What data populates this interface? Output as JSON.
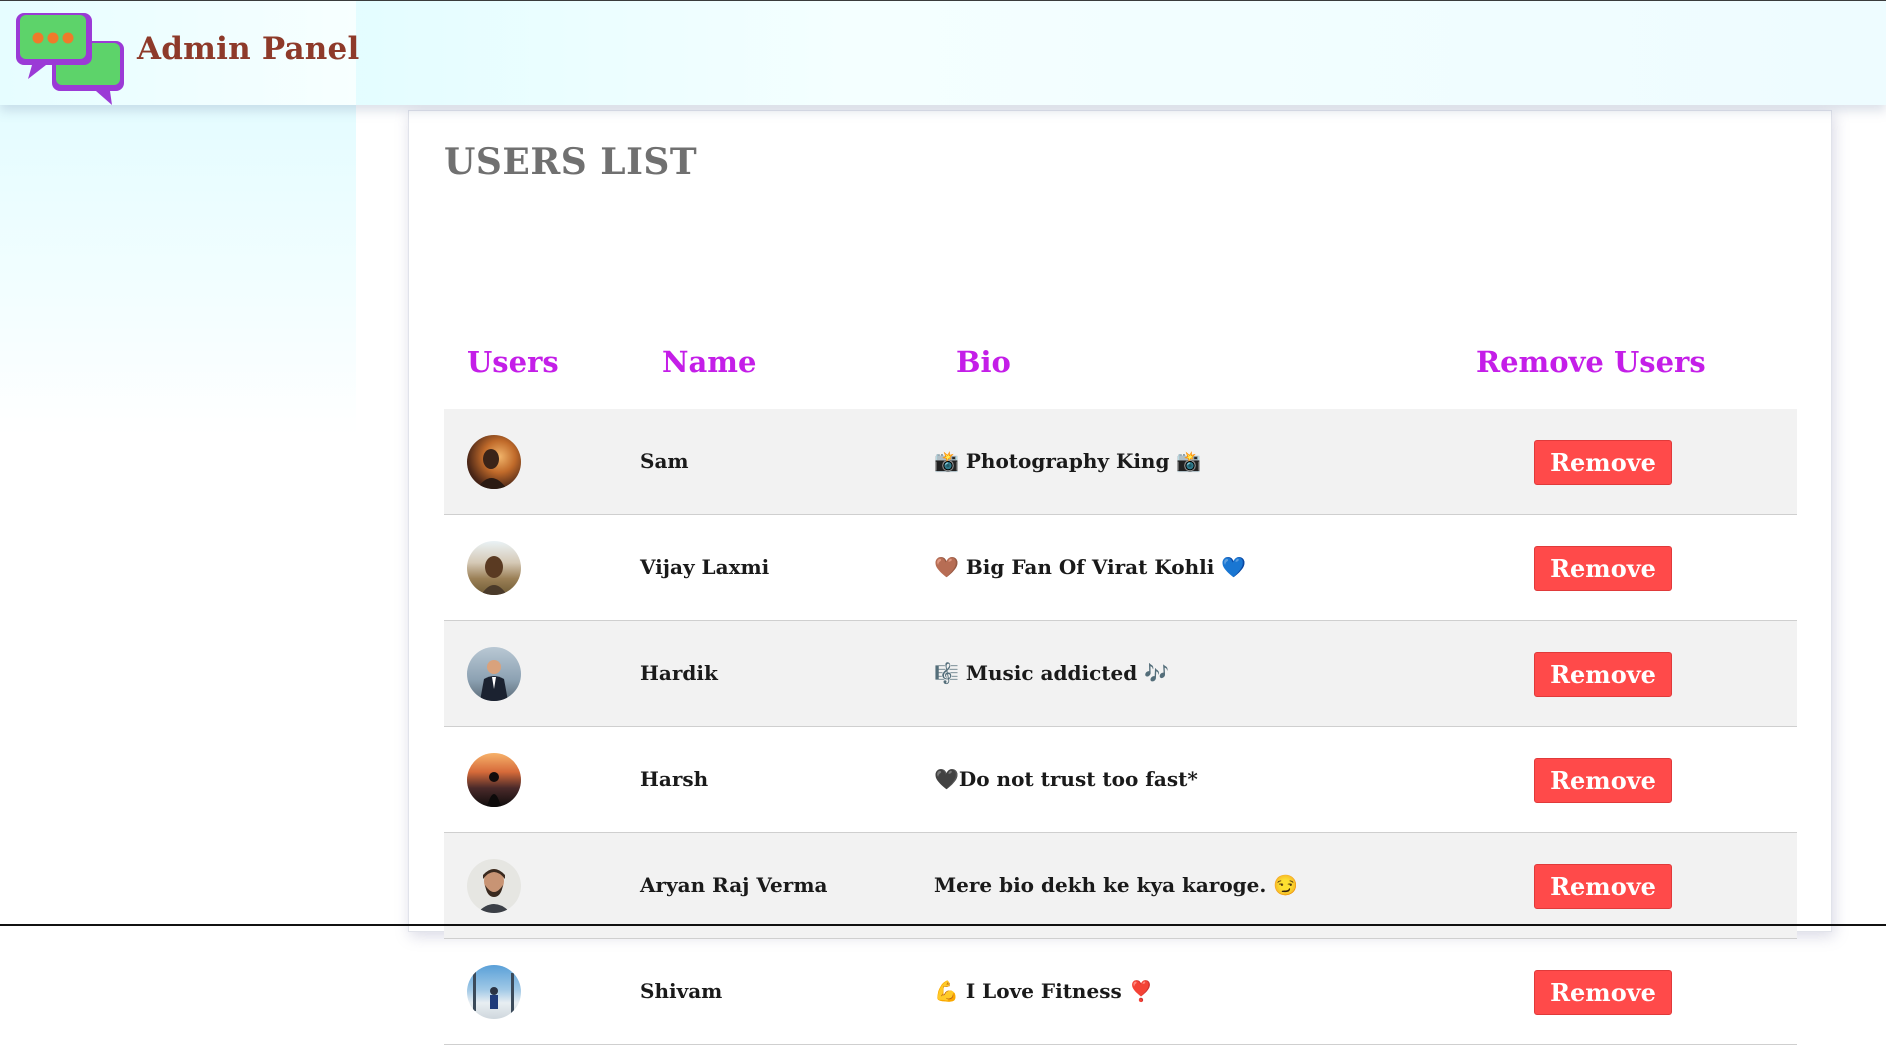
{
  "header": {
    "title": "Admin Panel",
    "logo_icon": "chat-bubbles-icon"
  },
  "main": {
    "title": "USERS LIST",
    "columns": {
      "users": "Users",
      "name": "Name",
      "bio": "Bio",
      "remove": "Remove Users"
    },
    "rows": [
      {
        "name": "Sam",
        "bio": "📸 Photography King 📸",
        "remove_label": "Remove"
      },
      {
        "name": "Vijay Laxmi",
        "bio": "🤎 Big Fan Of Virat Kohli 💙",
        "remove_label": "Remove"
      },
      {
        "name": "Hardik",
        "bio": "🎼 Music addicted 🎶",
        "remove_label": "Remove"
      },
      {
        "name": "Harsh",
        "bio": "🖤Do not trust too fast*",
        "remove_label": "Remove"
      },
      {
        "name": "Aryan Raj Verma",
        "bio": "Mere bio dekh ke kya karoge. 😏",
        "remove_label": "Remove"
      },
      {
        "name": "Shivam",
        "bio": "💪 I Love Fitness ❣️",
        "remove_label": "Remove"
      }
    ]
  },
  "colors": {
    "brand": "#8e3a2a",
    "column_header": "#c41ee8",
    "remove_button": "#ff4a4a",
    "title": "#707070"
  }
}
